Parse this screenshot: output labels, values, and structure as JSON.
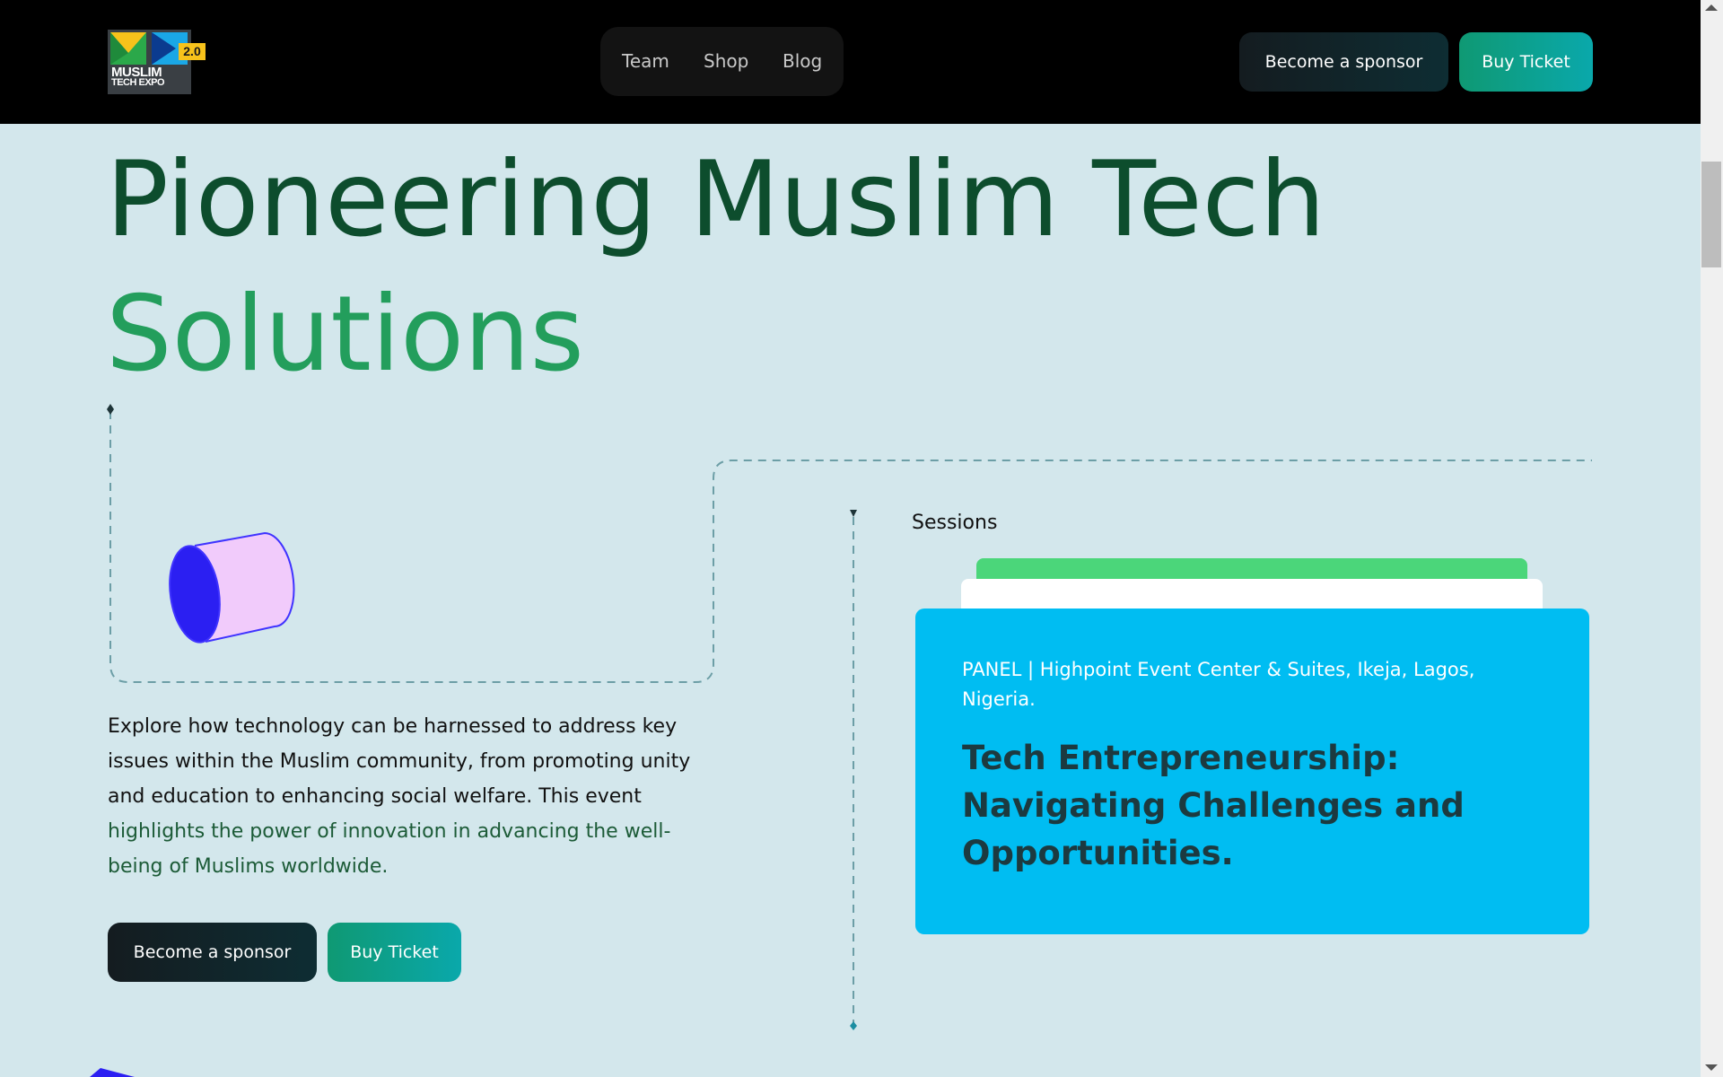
{
  "header": {
    "logo": {
      "line1": "MUSLIM",
      "line2": "TECH EXPO",
      "badge": "2.0"
    },
    "nav": [
      {
        "label": "Team"
      },
      {
        "label": "Shop"
      },
      {
        "label": "Blog"
      }
    ],
    "sponsor_label": "Become a sponsor",
    "ticket_label": "Buy Ticket"
  },
  "hero": {
    "title_line1": "Pioneering Muslim Tech",
    "title_line2": "Solutions",
    "intro_part1": "Explore how technology can be harnessed to address key issues within the Muslim community, from promoting unity and education to enhancing social welfare. This event ",
    "intro_part2": "highlights the power of innovation in advancing the well-being of Muslims worldwide.",
    "sponsor_label": "Become a sponsor",
    "ticket_label": "Buy Ticket"
  },
  "sessions": {
    "label": "Sessions",
    "card": {
      "meta": "PANEL | Highpoint Event Center & Suites, Ikeja, Lagos, Nigeria.",
      "title": "Tech Entrepreneurship: Navigating Challenges and Opportunities."
    }
  },
  "colors": {
    "page_bg": "#d3e7ec",
    "title_dark": "#0d4d2d",
    "title_green": "#239e5c",
    "card_blue": "#00bdf2",
    "teal_button": "#0aa8ab"
  },
  "icons": [
    "cylinder-illustration",
    "blue-shape-decoration"
  ]
}
